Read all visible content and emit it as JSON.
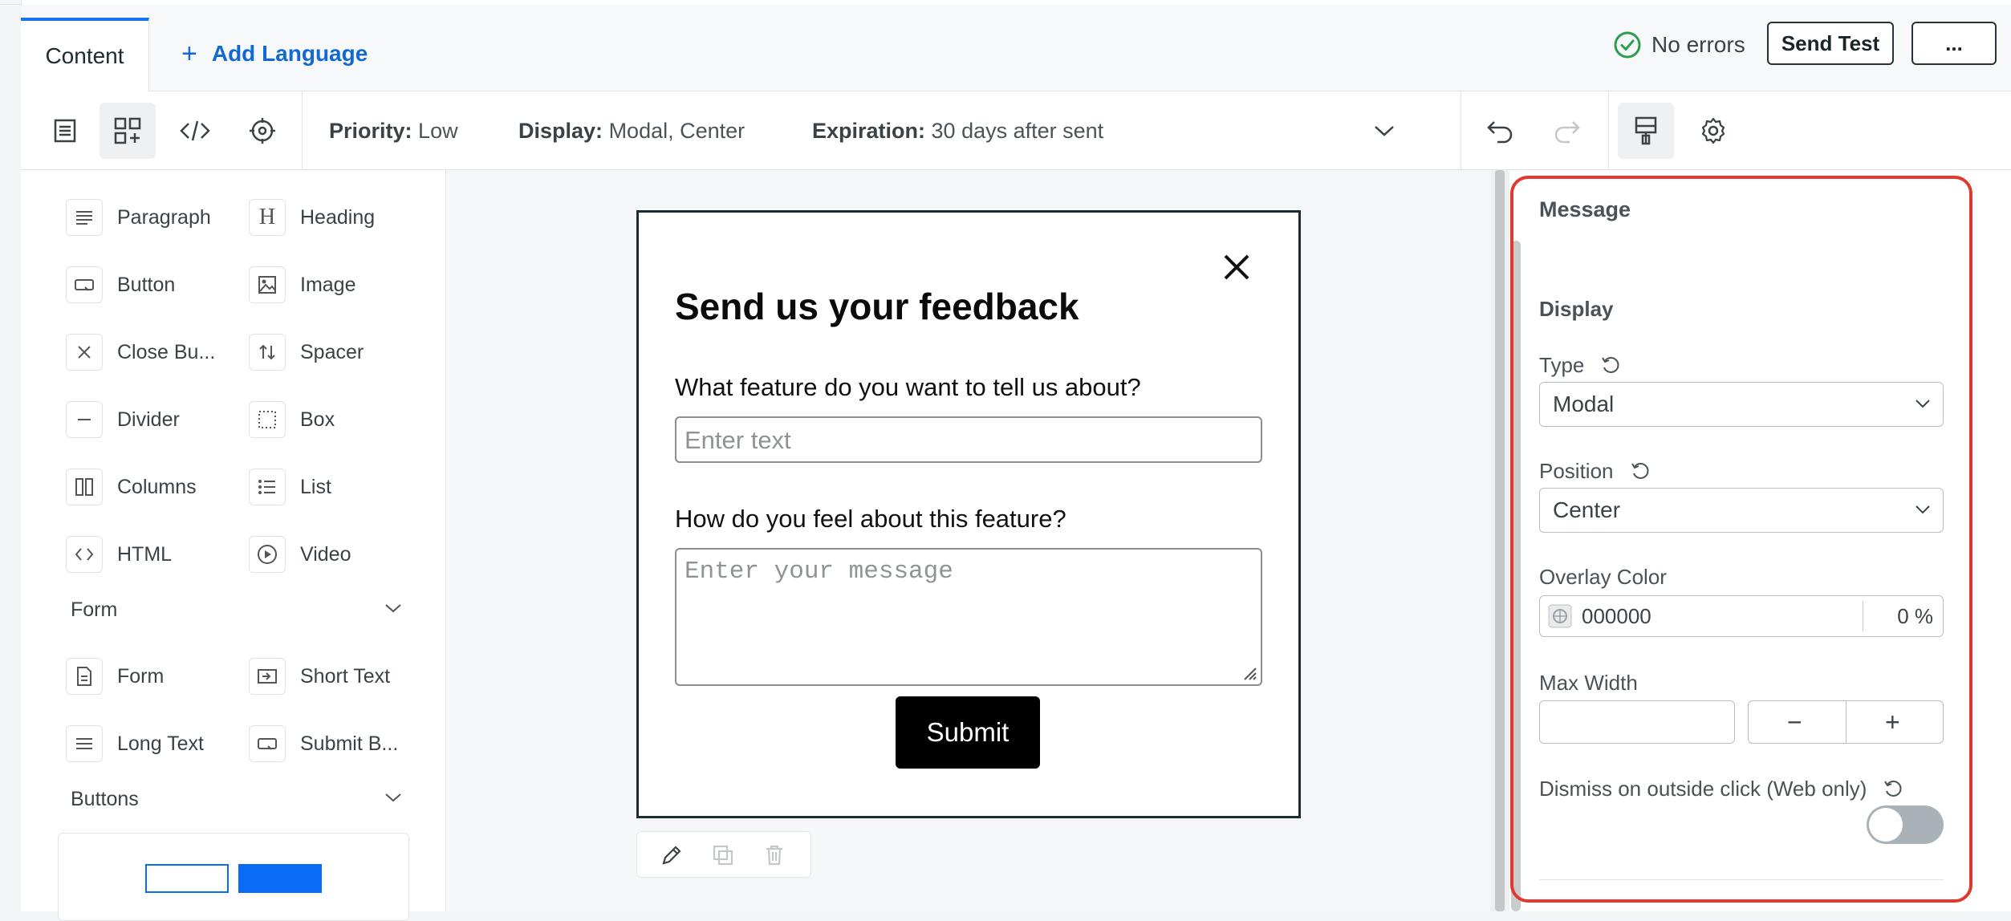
{
  "tabs": {
    "content": "Content",
    "add_language": "Add Language"
  },
  "status": {
    "no_errors": "No errors"
  },
  "actions": {
    "send_test": "Send Test",
    "more": "..."
  },
  "meta": {
    "priority_label": "Priority:",
    "priority_value": "Low",
    "display_label": "Display:",
    "display_value": "Modal, Center",
    "expiration_label": "Expiration:",
    "expiration_value": "30 days after sent"
  },
  "components": {
    "paragraph": "Paragraph",
    "heading": "Heading",
    "button": "Button",
    "image": "Image",
    "close_button": "Close Bu...",
    "spacer": "Spacer",
    "divider": "Divider",
    "box": "Box",
    "columns": "Columns",
    "list": "List",
    "html": "HTML",
    "video": "Video"
  },
  "form_section": {
    "title": "Form",
    "form": "Form",
    "short_text": "Short Text",
    "long_text": "Long Text",
    "submit_button": "Submit B..."
  },
  "buttons_section": {
    "title": "Buttons"
  },
  "modal": {
    "title": "Send us your feedback",
    "q1": "What feature do you want to tell us about?",
    "q1_placeholder": "Enter text",
    "q2": "How do you feel about this feature?",
    "q2_placeholder": "Enter your message",
    "submit": "Submit"
  },
  "settings": {
    "heading": "Message",
    "display_heading": "Display",
    "type_label": "Type",
    "type_value": "Modal",
    "position_label": "Position",
    "position_value": "Center",
    "overlay_label": "Overlay Color",
    "overlay_hex": "000000",
    "overlay_opacity": "0 %",
    "max_width_label": "Max Width",
    "dismiss_label": "Dismiss on outside click (Web only)",
    "dismiss_enabled": false
  },
  "colors": {
    "accent": "#1269d3",
    "highlight": "#e0392f",
    "preview_button": "#0a6cf5"
  }
}
